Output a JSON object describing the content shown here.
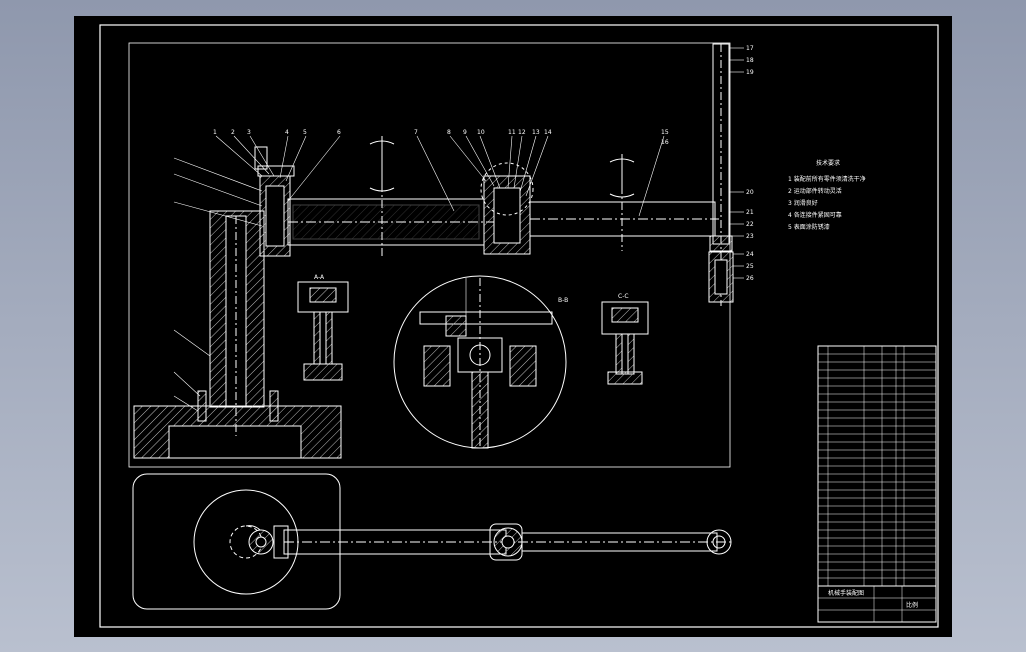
{
  "colors": {
    "window_background": "#a0a8bb",
    "canvas_background": "#000000",
    "line_color": "#ffffff",
    "hatch_color": "#bfbfbf"
  },
  "drawing": {
    "notes_title": "技术要求",
    "notes": [
      "1 装配前所有零件须清洗干净",
      "2 运动部件转动灵活",
      "3 润滑良好",
      "4 各连接件紧固可靠",
      "5 表面涂防锈漆"
    ],
    "section_labels": [
      "A-A",
      "B-B",
      "C-C"
    ],
    "balloons_top": [
      "1",
      "2",
      "3",
      "4",
      "5",
      "6",
      "7",
      "8",
      "9",
      "10",
      "11",
      "12",
      "13",
      "14",
      "15",
      "16"
    ],
    "balloons_right": [
      "17",
      "18",
      "19",
      "20",
      "21",
      "22",
      "23",
      "24",
      "25",
      "26"
    ],
    "title_block": {
      "drawing_name": "机械手装配图",
      "scale_label": "比例",
      "row_count": 30
    }
  }
}
